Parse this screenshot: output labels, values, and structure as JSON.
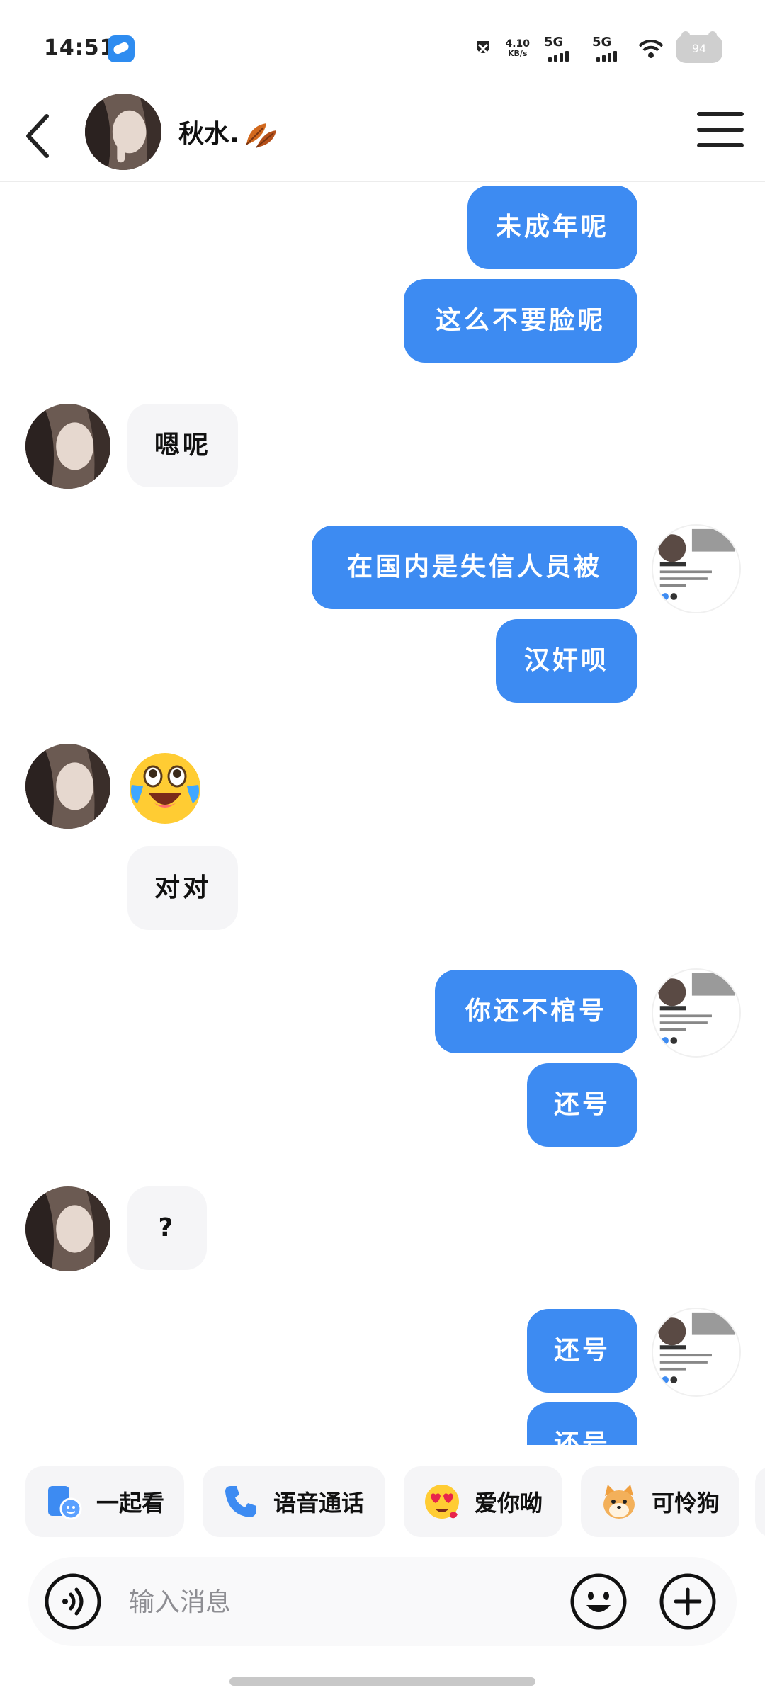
{
  "status_bar": {
    "time": "14:51",
    "net_speed_value": "4.10",
    "net_speed_unit": "KB/s",
    "signal_1": "5G",
    "signal_2": "5G",
    "battery": "94",
    "icons": [
      "app-icon",
      "mute-icon",
      "signal-icon",
      "wifi-icon",
      "battery-icon"
    ]
  },
  "header": {
    "contact_name": "秋水.",
    "icons": [
      "back-icon",
      "leaf-emoji",
      "menu-icon"
    ]
  },
  "messages": [
    {
      "sender": "me",
      "text": "未成年呢"
    },
    {
      "sender": "me",
      "text": "这么不要脸呢"
    },
    {
      "sender": "contact",
      "text": "嗯呢"
    },
    {
      "sender": "me",
      "text": "在国内是失信人员被"
    },
    {
      "sender": "me",
      "text": "汉奸呗"
    },
    {
      "sender": "contact",
      "type": "emoji",
      "emoji": "laughing-crying-emoji"
    },
    {
      "sender": "contact",
      "text": "对对"
    },
    {
      "sender": "me",
      "text": "你还不棺号"
    },
    {
      "sender": "me",
      "text": "还号"
    },
    {
      "sender": "contact",
      "text": "?"
    },
    {
      "sender": "me",
      "text": "还号"
    },
    {
      "sender": "me",
      "text": "还号"
    }
  ],
  "quick_actions": [
    {
      "label": "一起看",
      "icon": "watch-together-icon"
    },
    {
      "label": "语音通话",
      "icon": "phone-icon"
    },
    {
      "label": "爱你呦",
      "icon": "heart-eyes-sticker-icon"
    },
    {
      "label": "可怜狗",
      "icon": "shiba-sticker-icon"
    }
  ],
  "input_bar": {
    "placeholder": "输入消息",
    "value": "",
    "icons": [
      "voice-icon",
      "emoji-icon",
      "plus-icon"
    ]
  },
  "colors": {
    "outgoing_bubble": "#3d8bf2",
    "incoming_bubble": "#f5f5f7",
    "background": "#ffffff"
  }
}
